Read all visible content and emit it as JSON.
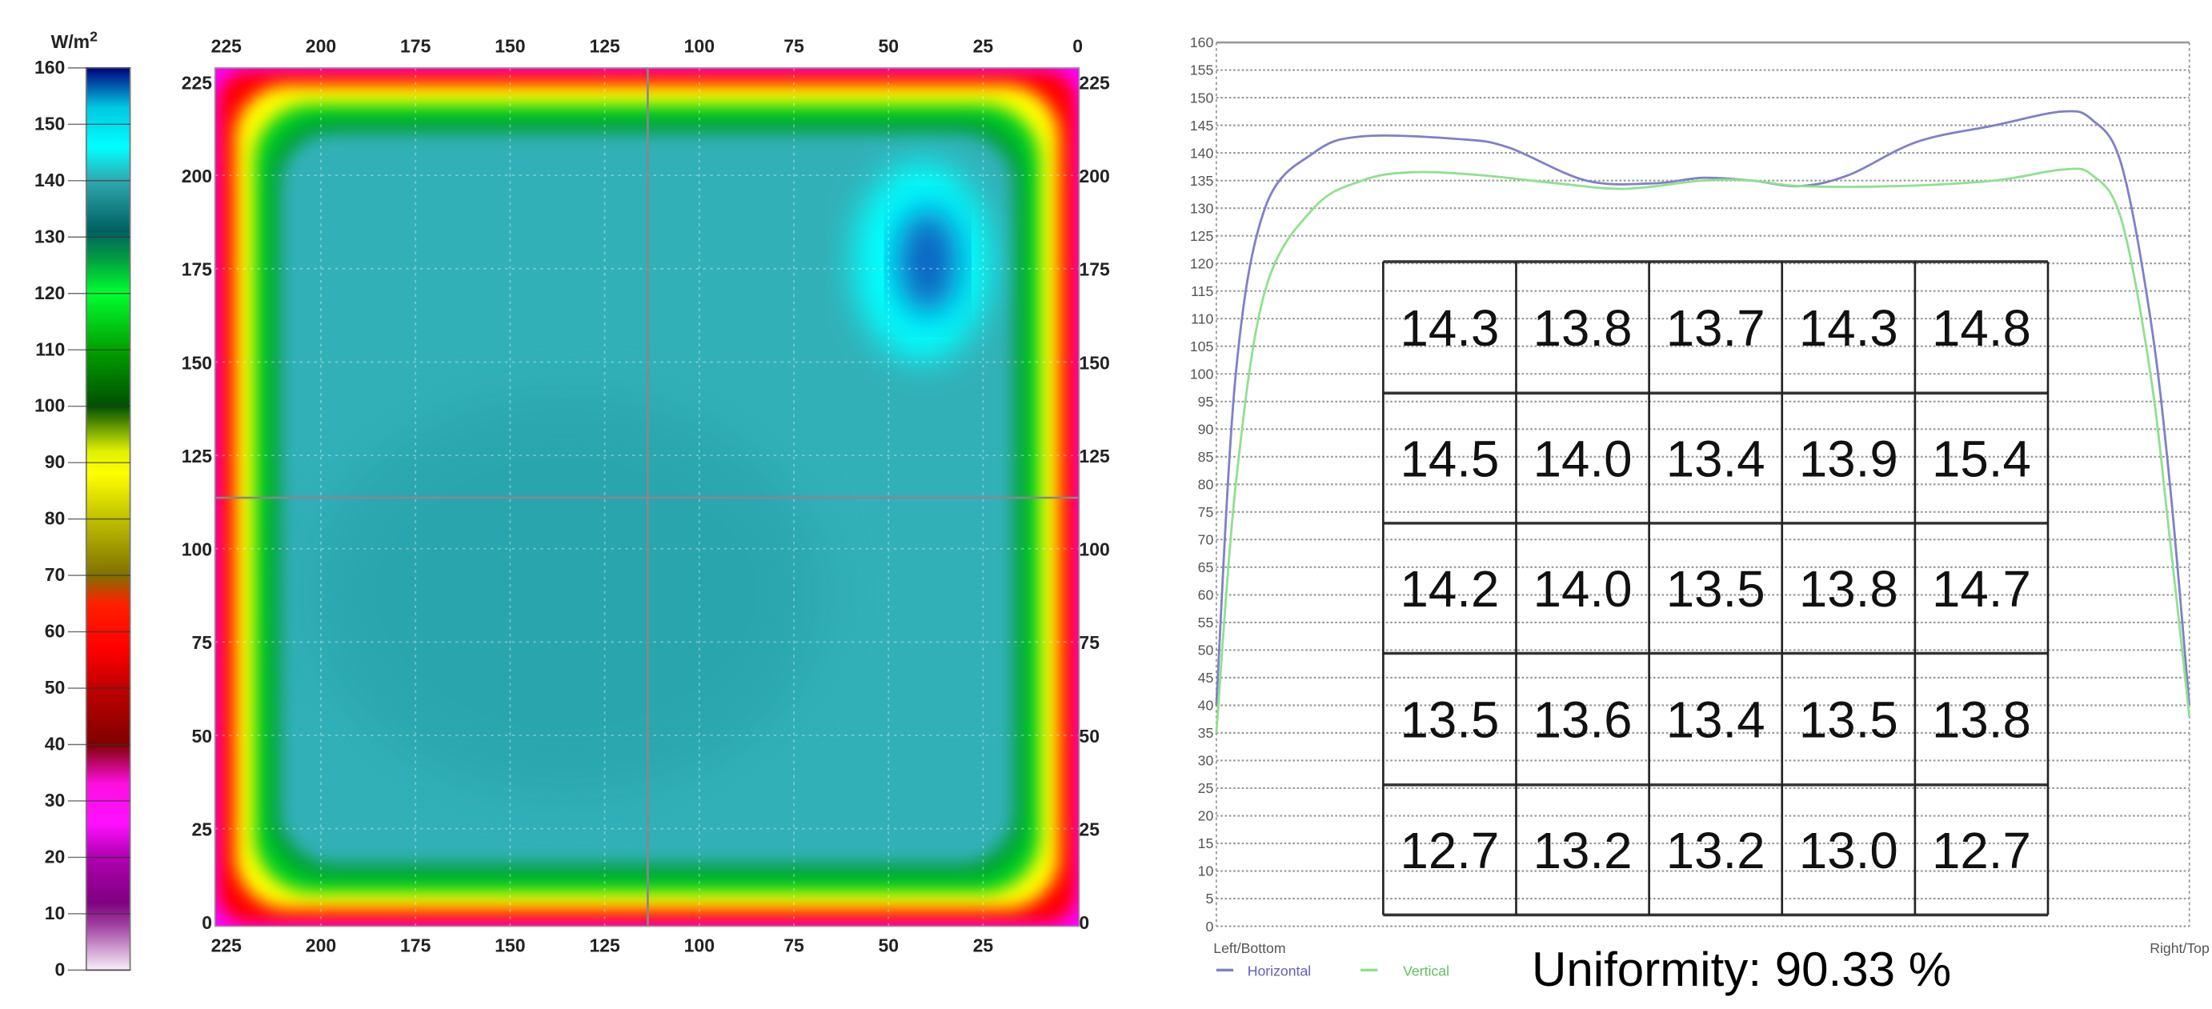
{
  "chart_data": [
    {
      "type": "heatmap",
      "colorbar": {
        "unit_label": "W/m",
        "unit_superscript": "2",
        "range": [
          0,
          160
        ],
        "ticks": [
          0,
          10,
          20,
          30,
          40,
          50,
          60,
          70,
          80,
          90,
          100,
          110,
          120,
          130,
          140,
          150,
          160
        ],
        "stops": [
          {
            "v": 0,
            "c": "#f8f0f8"
          },
          {
            "v": 8,
            "c": "#a040a0"
          },
          {
            "v": 12,
            "c": "#800080"
          },
          {
            "v": 20,
            "c": "#b000b0"
          },
          {
            "v": 26,
            "c": "#ff10ff"
          },
          {
            "v": 33,
            "c": "#ff10e0"
          },
          {
            "v": 40,
            "c": "#800000"
          },
          {
            "v": 50,
            "c": "#c00000"
          },
          {
            "v": 57,
            "c": "#ff0000"
          },
          {
            "v": 65,
            "c": "#ff2000"
          },
          {
            "v": 70,
            "c": "#807000"
          },
          {
            "v": 80,
            "c": "#c0c000"
          },
          {
            "v": 88,
            "c": "#ffff00"
          },
          {
            "v": 92,
            "c": "#e0f000"
          },
          {
            "v": 100,
            "c": "#005000"
          },
          {
            "v": 110,
            "c": "#00a000"
          },
          {
            "v": 120,
            "c": "#00ff30"
          },
          {
            "v": 126,
            "c": "#00a040"
          },
          {
            "v": 131,
            "c": "#006060"
          },
          {
            "v": 140,
            "c": "#30a8b0"
          },
          {
            "v": 146,
            "c": "#00ffff"
          },
          {
            "v": 153,
            "c": "#00c8e0"
          },
          {
            "v": 160,
            "c": "#000080"
          }
        ]
      },
      "x_ticks_top": [
        225,
        200,
        175,
        150,
        125,
        100,
        75,
        50,
        25,
        0
      ],
      "x_ticks_bottom": [
        225,
        200,
        175,
        150,
        125,
        100,
        75,
        50,
        25
      ],
      "y_ticks_left": [
        225,
        200,
        175,
        150,
        125,
        100,
        75,
        50,
        25,
        0
      ],
      "y_ticks_right": [
        225,
        200,
        175,
        150,
        125,
        100,
        75,
        50,
        25,
        0
      ],
      "x_range": [
        225,
        0
      ],
      "y_range": [
        0,
        225
      ],
      "crosshair": {
        "x": 114,
        "y": 114
      },
      "hotspot": {
        "x": 40,
        "y": 165,
        "value": 158
      },
      "colors": {
        "edge": "#ff0000",
        "ring_yellow": "#ffff00",
        "ring_green": "#00d020",
        "ring_darkgreen": "#00a030",
        "interior": "#30b0b8",
        "corner": "#ff00ff"
      }
    },
    {
      "type": "line",
      "ylim": [
        0,
        160
      ],
      "y_ticks": [
        0,
        5,
        10,
        15,
        20,
        25,
        30,
        35,
        40,
        45,
        50,
        55,
        60,
        65,
        70,
        75,
        80,
        85,
        90,
        95,
        100,
        105,
        110,
        115,
        120,
        125,
        130,
        135,
        140,
        145,
        150,
        155,
        160
      ],
      "xlabel_left": "Left/Bottom",
      "xlabel_right": "Right/Top",
      "grid": true,
      "series": [
        {
          "name": "Horizontal",
          "color": "#8080c8",
          "x": [
            0,
            0.02,
            0.05,
            0.1,
            0.15,
            0.25,
            0.3,
            0.38,
            0.45,
            0.5,
            0.55,
            0.6,
            0.65,
            0.72,
            0.8,
            0.87,
            0.9,
            0.93,
            0.96,
            0.98,
            1.0
          ],
          "y": [
            40,
            100,
            130,
            140,
            143,
            142.5,
            141,
            135,
            134.5,
            135.5,
            135,
            134,
            136,
            142,
            145,
            147.5,
            146,
            138,
            110,
            80,
            40
          ]
        },
        {
          "name": "Vertical",
          "color": "#90e090",
          "x": [
            0,
            0.02,
            0.05,
            0.1,
            0.15,
            0.2,
            0.27,
            0.35,
            0.42,
            0.5,
            0.55,
            0.6,
            0.7,
            0.8,
            0.87,
            0.9,
            0.93,
            0.96,
            0.98,
            1.0
          ],
          "y": [
            35,
            80,
            115,
            130,
            135,
            136.5,
            136,
            134.5,
            133.5,
            135,
            135,
            134,
            134,
            135,
            137,
            136,
            128,
            100,
            70,
            38
          ]
        }
      ],
      "grid_table": [
        [
          "14.3",
          "13.8",
          "13.7",
          "14.3",
          "14.8"
        ],
        [
          "14.5",
          "14.0",
          "13.4",
          "13.9",
          "15.4"
        ],
        [
          "14.2",
          "14.0",
          "13.5",
          "13.8",
          "14.7"
        ],
        [
          "13.5",
          "13.6",
          "13.4",
          "13.5",
          "13.8"
        ],
        [
          "12.7",
          "13.2",
          "13.2",
          "13.0",
          "12.7"
        ]
      ],
      "uniformity_label": "Uniformity: 90.33 %"
    }
  ]
}
